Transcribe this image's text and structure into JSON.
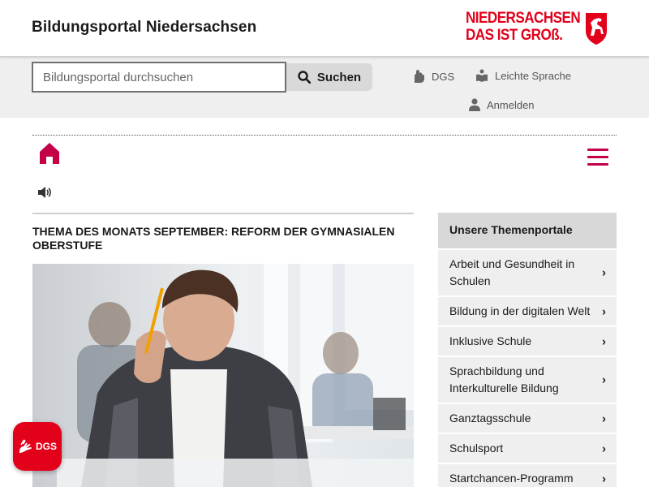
{
  "header": {
    "site_title": "Bildungsportal Niedersachsen",
    "logo_line1": "NIEDERSACHSEN",
    "logo_line2": "DAS IST GROß."
  },
  "search": {
    "placeholder": "Bildungsportal durchsuchen",
    "value": "",
    "button_label": "Suchen"
  },
  "utility": {
    "dgs_label": "DGS",
    "easy_language_label": "Leichte Sprache",
    "login_label": "Anmelden"
  },
  "article": {
    "title": "THEMA DES MONATS SEPTEMBER: REFORM DER GYMNASIALEN OBERSTUFE"
  },
  "sidebar": {
    "heading": "Unsere Themenportale",
    "items": [
      {
        "label": "Arbeit und Gesundheit in Schulen"
      },
      {
        "label": "Bildung in der digitalen Welt"
      },
      {
        "label": "Inklusive Schule"
      },
      {
        "label": "Sprachbildung und Interkulturelle Bildung"
      },
      {
        "label": "Ganztagsschule"
      },
      {
        "label": "Schulsport"
      },
      {
        "label": "Startchancen-Programm"
      }
    ]
  },
  "fab": {
    "label": "DGS"
  },
  "colors": {
    "brand_red": "#e3001b",
    "accent_magenta": "#c40049",
    "header_gray": "#efefef"
  },
  "icons": [
    "search-icon",
    "dgs-hands-icon",
    "book-icon",
    "user-icon",
    "home-icon",
    "menu-icon",
    "speaker-icon",
    "chevron-right-icon",
    "niedersachsen-horse-icon"
  ]
}
